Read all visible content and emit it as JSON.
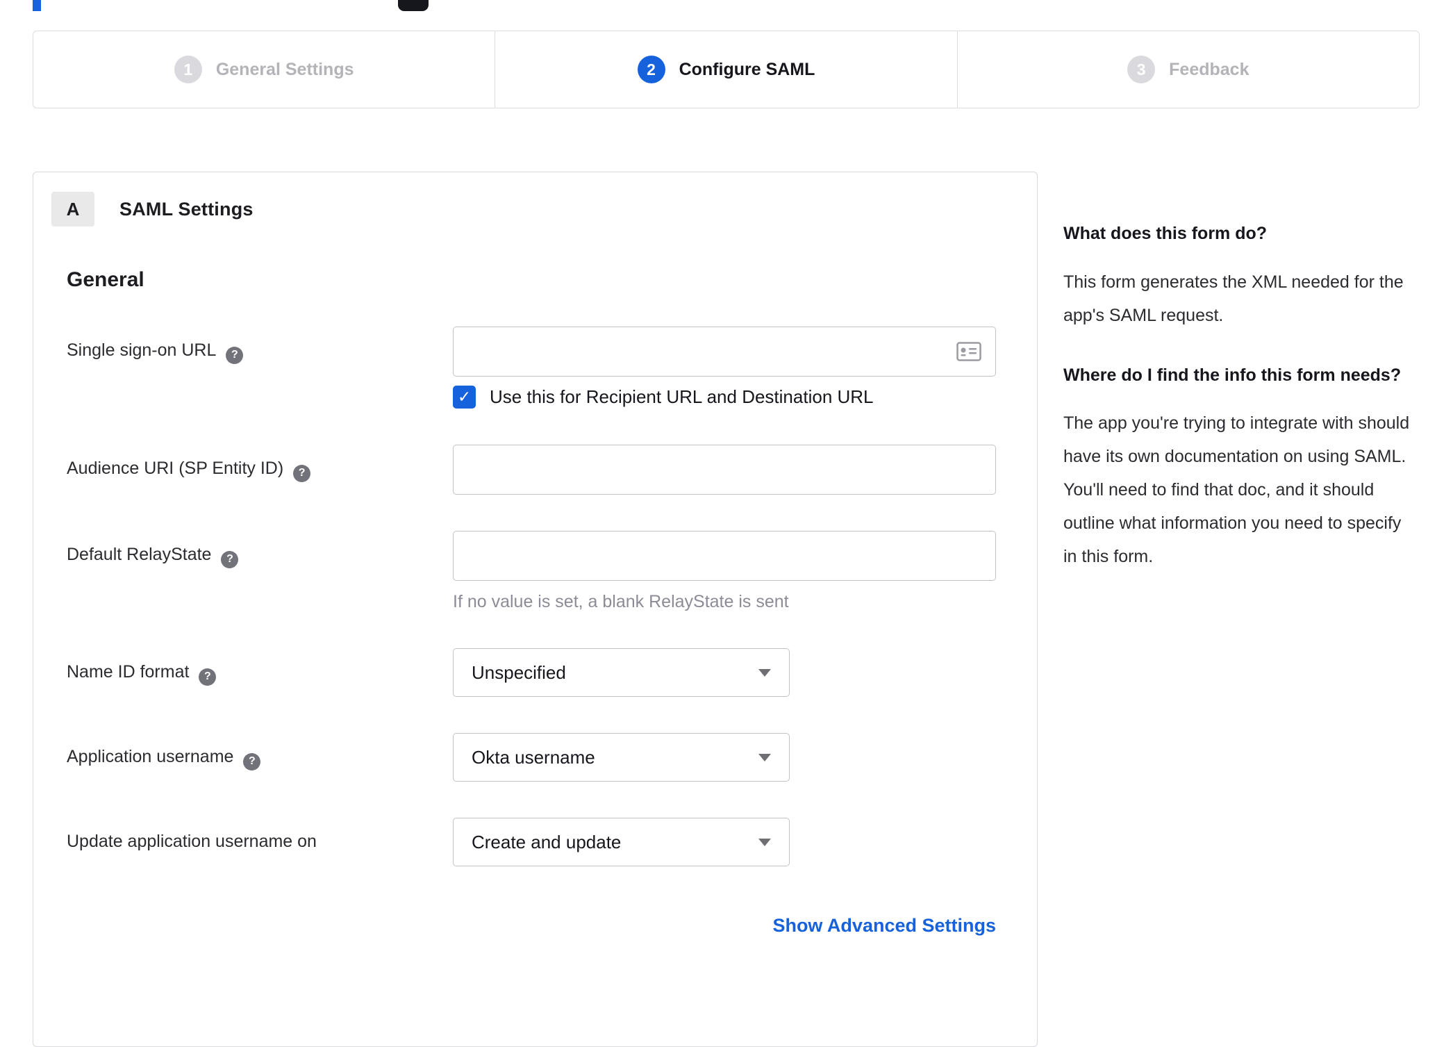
{
  "accent_color": "#1662dd",
  "stepper": {
    "steps": [
      {
        "number": "1",
        "label": "General Settings",
        "state": "inactive"
      },
      {
        "number": "2",
        "label": "Configure SAML",
        "state": "active"
      },
      {
        "number": "3",
        "label": "Feedback",
        "state": "inactive"
      }
    ]
  },
  "panel": {
    "badge": "A",
    "title": "SAML Settings",
    "section_heading": "General",
    "fields": {
      "sso": {
        "label": "Single sign-on URL",
        "value": "",
        "checkbox_label": "Use this for Recipient URL and Destination URL",
        "checked": true
      },
      "audience": {
        "label": "Audience URI (SP Entity ID)",
        "value": ""
      },
      "relay": {
        "label": "Default RelayState",
        "value": "",
        "hint": "If no value is set, a blank RelayState is sent"
      },
      "nameid": {
        "label": "Name ID format",
        "value": "Unspecified"
      },
      "appuser": {
        "label": "Application username",
        "value": "Okta username"
      },
      "updateuser": {
        "label": "Update application username on",
        "value": "Create and update"
      }
    },
    "advanced_link": "Show Advanced Settings"
  },
  "sidebar": {
    "q1": "What does this form do?",
    "a1": "This form generates the XML needed for the app's SAML request.",
    "q2": "Where do I find the info this form needs?",
    "a2": "The app you're trying to integrate with should have its own documentation on using SAML. You'll need to find that doc, and it should outline what information you need to specify in this form."
  },
  "icons": {
    "help": "question-circle",
    "sso_input": "contact-card",
    "checkbox": "checkmark",
    "select": "chevron-down-caret"
  }
}
